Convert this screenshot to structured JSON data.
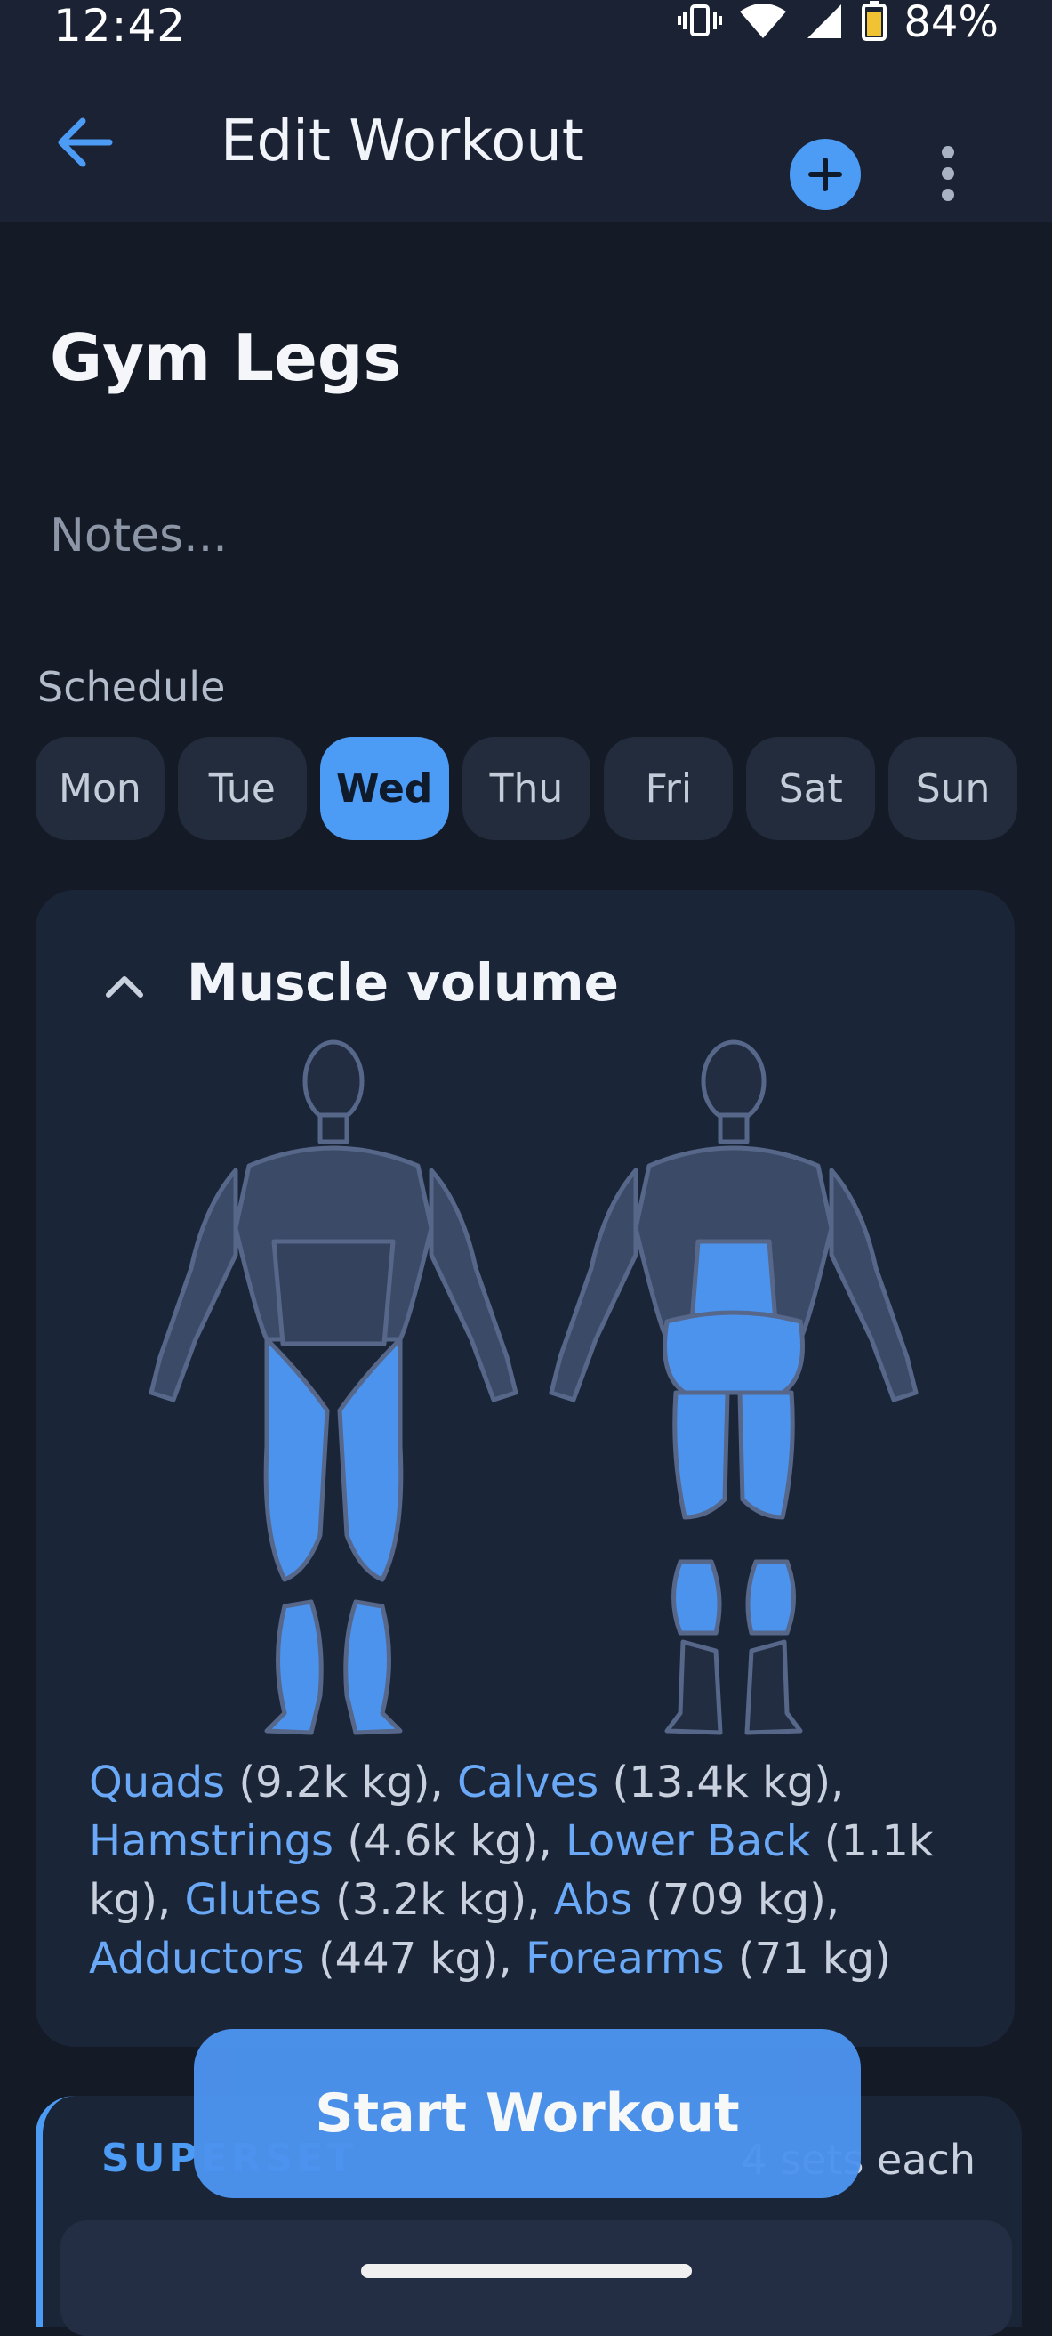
{
  "status": {
    "time": "12:42",
    "battery": "84%"
  },
  "appbar": {
    "title": "Edit Workout"
  },
  "workout": {
    "name": "Gym Legs",
    "notes_placeholder": "Notes..."
  },
  "schedule": {
    "label": "Schedule",
    "days": [
      "Mon",
      "Tue",
      "Wed",
      "Thu",
      "Fri",
      "Sat",
      "Sun"
    ],
    "selected": "Wed"
  },
  "muscle_volume": {
    "title": "Muscle volume",
    "items": [
      {
        "muscle": "Quads",
        "volume": "(9.2k kg)"
      },
      {
        "muscle": "Calves",
        "volume": "(13.4k kg)"
      },
      {
        "muscle": "Hamstrings",
        "volume": "(4.6k kg)"
      },
      {
        "muscle": "Lower Back",
        "volume": "(1.1k kg)"
      },
      {
        "muscle": "Glutes",
        "volume": "(3.2k kg)"
      },
      {
        "muscle": "Abs",
        "volume": "(709 kg)"
      },
      {
        "muscle": "Adductors",
        "volume": "(447 kg)"
      },
      {
        "muscle": "Forearms",
        "volume": "(71 kg)"
      }
    ]
  },
  "superset": {
    "label": "SUPERSET",
    "sets": "4 sets each"
  },
  "actions": {
    "start": "Start Workout"
  },
  "colors": {
    "accent": "#4c9bf5",
    "background": "#151b26",
    "card": "#1b2538"
  }
}
